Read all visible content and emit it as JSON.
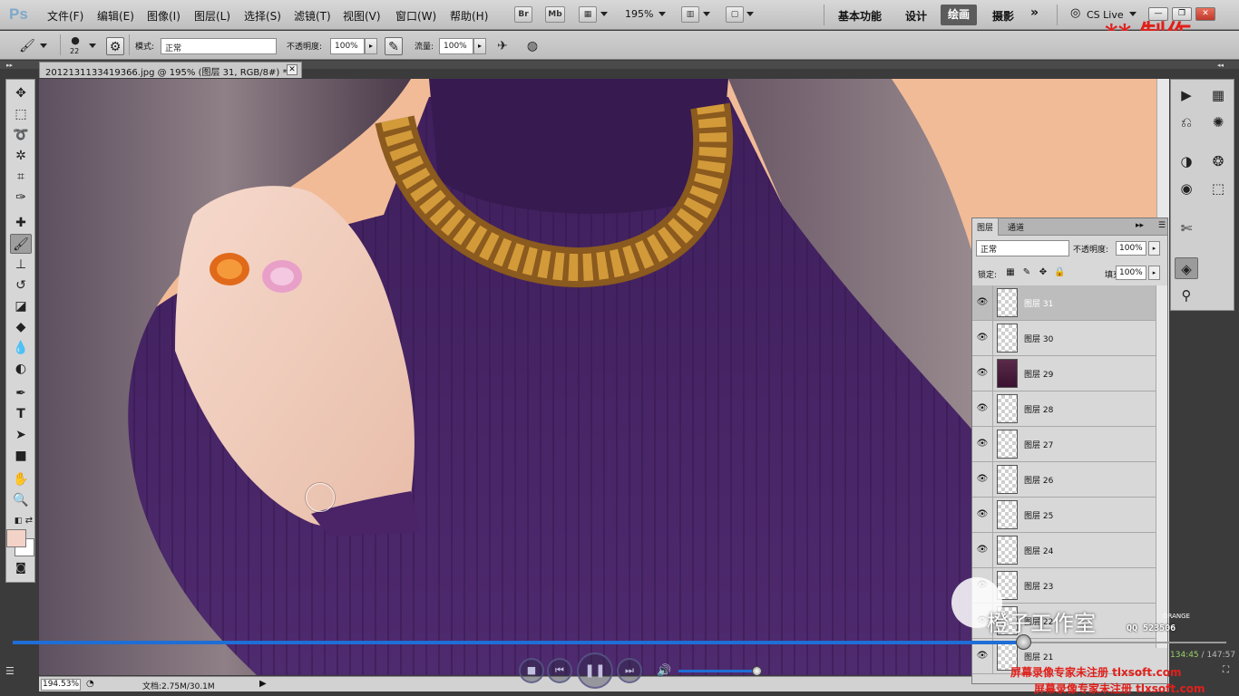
{
  "app": {
    "logo": "Ps",
    "menu": [
      "文件(F)",
      "编辑(E)",
      "图像(I)",
      "图层(L)",
      "选择(S)",
      "滤镜(T)",
      "视图(V)",
      "窗口(W)",
      "帮助(H)"
    ],
    "bridge_btn": "Br",
    "minibridge_btn": "Mb",
    "zoom": "195%",
    "workspaces": [
      "基本功能",
      "设计",
      "绘画",
      "摄影"
    ],
    "active_workspace": "绘画",
    "more_workspaces": "»",
    "cs_live": "CS Live",
    "watermark_top": "** 制作"
  },
  "options": {
    "brush_size": "22",
    "mode_label": "模式:",
    "mode_value": "正常",
    "opacity_label": "不透明度:",
    "opacity_value": "100%",
    "flow_label": "流量:",
    "flow_value": "100%"
  },
  "document": {
    "tab_title": "2012131133419366.jpg @ 195% (图层 31, RGB/8#) *",
    "zoom_readout": "194.53%",
    "doc_info": "文档:2.75M/30.1M"
  },
  "layers_panel": {
    "tabs": [
      "图层",
      "通道"
    ],
    "blend_mode": "正常",
    "opacity_label": "不透明度:",
    "opacity_value": "100%",
    "lock_label": "锁定:",
    "fill_label": "填充:",
    "fill_value": "100%",
    "layers": [
      {
        "name": "图层 31",
        "selected": true,
        "thumb": "transparent"
      },
      {
        "name": "图层 30",
        "selected": false,
        "thumb": "transparent"
      },
      {
        "name": "图层 29",
        "selected": false,
        "thumb": "photo"
      },
      {
        "name": "图层 28",
        "selected": false,
        "thumb": "transparent"
      },
      {
        "name": "图层 27",
        "selected": false,
        "thumb": "transparent"
      },
      {
        "name": "图层 26",
        "selected": false,
        "thumb": "transparent"
      },
      {
        "name": "图层 25",
        "selected": false,
        "thumb": "transparent"
      },
      {
        "name": "图层 24",
        "selected": false,
        "thumb": "transparent"
      },
      {
        "name": "图层 23",
        "selected": false,
        "thumb": "transparent"
      },
      {
        "name": "图层 22",
        "selected": false,
        "thumb": "transparent"
      },
      {
        "name": "图层 21",
        "selected": false,
        "thumb": "transparent"
      }
    ]
  },
  "overlay": {
    "studio_name": "橙子工作室",
    "studio_small": "ORANGE",
    "studio_code": "QQ 523506",
    "time_current": "134:45",
    "time_separator": " / ",
    "time_total": "147:57",
    "progress_fraction": 0.9,
    "volume_fraction": 0.95,
    "watermark_lines": [
      "屏幕录像专家未注册 tlxsoft.com",
      "屏幕录像专家未注册 tlxsoft.com"
    ]
  },
  "colors": {
    "foreground": "#f3d3c8",
    "background": "#ffffff",
    "accent": "#1f6ed6",
    "sweater": "#4a2466"
  }
}
